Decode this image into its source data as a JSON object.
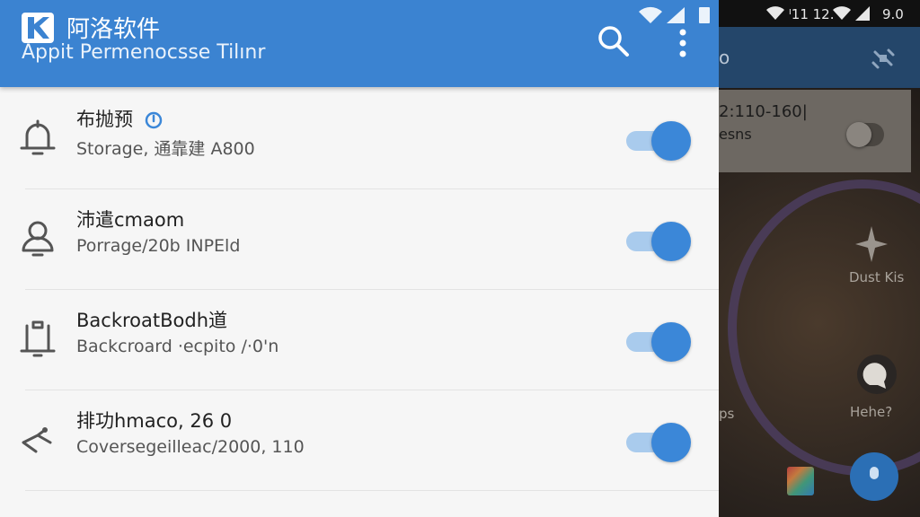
{
  "app": {
    "title": "阿洛软件",
    "subtitle": "Appit Permenocsse Tilınr",
    "accent_color": "#3b83d1",
    "actions": [
      {
        "name": "search-icon"
      },
      {
        "name": "more-vert-icon"
      }
    ]
  },
  "settings": [
    {
      "title": "布抛预",
      "subtitle": "Storage, 通靠建 A800",
      "icon": "bell-icon",
      "badge": "info-icon",
      "enabled": true
    },
    {
      "title": "沛遣cmaom",
      "subtitle": "Porrage/20b INPEld",
      "icon": "person-icon",
      "enabled": true
    },
    {
      "title": "BackroatBodh道",
      "subtitle": "Backcroard ·ecpito /·0'n",
      "icon": "clipboard-icon",
      "enabled": true
    },
    {
      "title": "排功hmaco, 26 0",
      "subtitle": "Coversegeilleac/2000, 110",
      "icon": "share-icon",
      "enabled": true
    }
  ],
  "background_app": {
    "status_left": "ᴵ11 12.",
    "status_right": "9.0",
    "toolbar_title": "o",
    "card_line1": "2:110-160|",
    "card_line2": "esns",
    "label_star": "Dust Kis",
    "label_ps": "ps",
    "label_hehe": "Hehe?"
  }
}
